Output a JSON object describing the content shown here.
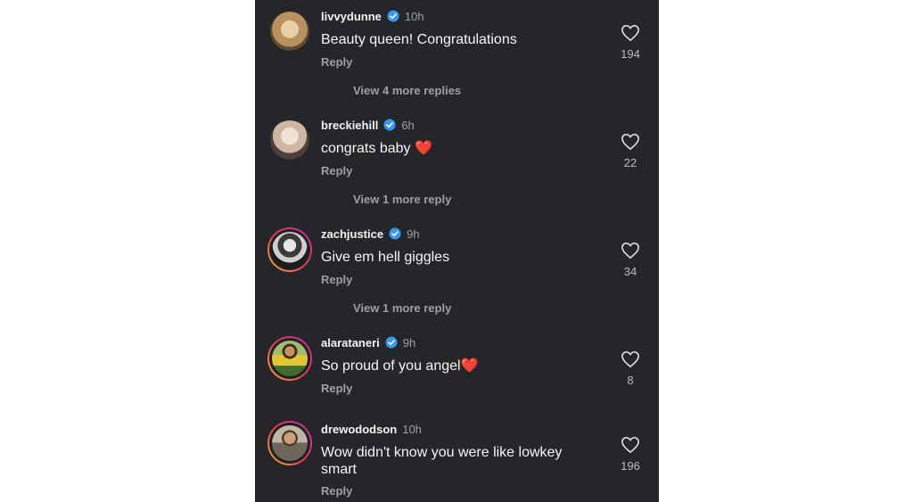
{
  "comments": [
    {
      "username": "livvydunne",
      "time": "10h",
      "text": "Beauty queen! Congratulations",
      "emoji": "",
      "reply_label": "Reply",
      "likes": "194",
      "view_more": "View 4 more replies",
      "story": false,
      "avatar_color": "#c9a36e"
    },
    {
      "username": "breckiehill",
      "time": "6h",
      "text": "congrats baby",
      "emoji": "❤️",
      "reply_label": "Reply",
      "likes": "22",
      "view_more": "View 1 more reply",
      "story": false,
      "avatar_color": "#d9c8b8"
    },
    {
      "username": "zachjustice",
      "time": "9h",
      "text": "Give em hell giggles",
      "emoji": "",
      "reply_label": "Reply",
      "likes": "34",
      "view_more": "View 1 more reply",
      "story": true,
      "avatar_color": "#8a8a8a"
    },
    {
      "username": "alarataneri",
      "time": "9h",
      "text": "So proud of you angel",
      "emoji": "❤️",
      "reply_label": "Reply",
      "likes": "8",
      "view_more": "",
      "story": true,
      "avatar_color": "#c6a33a"
    },
    {
      "username": "drewododson",
      "time": "10h",
      "text": "Wow didn't know you were like lowkey smart",
      "emoji": "",
      "reply_label": "Reply",
      "likes": "196",
      "view_more": "",
      "story": true,
      "avatar_color": "#7b7365"
    }
  ],
  "colors": {
    "background": "#25262a",
    "verified": "#3897f0",
    "like_outline": "#dddddd"
  },
  "icons": {
    "verified": "verified-badge-icon",
    "like": "heart-outline-icon"
  }
}
